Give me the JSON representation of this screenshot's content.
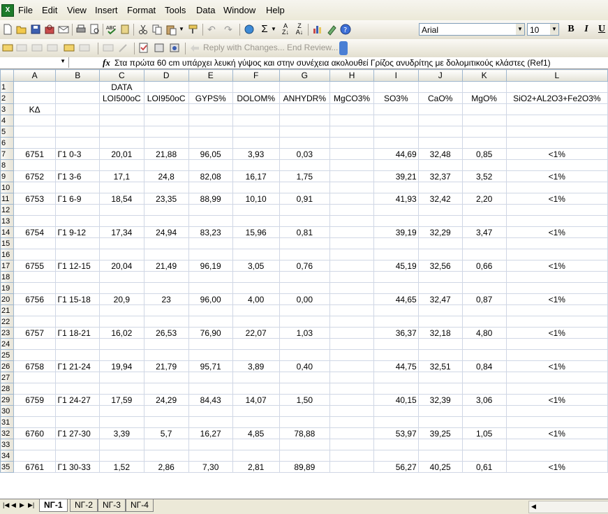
{
  "menu": [
    "File",
    "Edit",
    "View",
    "Insert",
    "Format",
    "Tools",
    "Data",
    "Window",
    "Help"
  ],
  "toolbar": {
    "font_name": "Arial",
    "font_size": "10",
    "bold": "B",
    "italic": "I",
    "underline": "U",
    "reply": "Reply with Changes...",
    "end_review": "End Review..."
  },
  "formula_bar": {
    "fx": "fx",
    "content": "Στα πρώτα 60 cm υπάρχει λευκή γύψος και στην συνέχεια ακολουθεί Γρίζος ανυδρίτης με δολομιτικούς κλάστες (Ref1)"
  },
  "columns": [
    "A",
    "B",
    "C",
    "D",
    "E",
    "F",
    "G",
    "H",
    "I",
    "J",
    "K",
    "L"
  ],
  "header_rows": {
    "r1": {
      "C": "DATA"
    },
    "r2": [
      "",
      "",
      "LOI500oC",
      "LOI950oC",
      "GYPS%",
      "DOLOM%",
      "ANHYDR%",
      "MgCO3%",
      "SO3%",
      "CaO%",
      "MgO%",
      "SiO2+AL2O3+Fe2O3%"
    ],
    "r3": {
      "A": "ΚΔ"
    }
  },
  "rows": [
    {
      "row": 7,
      "code": "6751",
      "sample": "Γ1 0-3",
      "loi500": "20,01",
      "loi950": "21,88",
      "gyps": "96,05",
      "dolom": "3,93",
      "anhydr": "0,03",
      "so3": "44,69",
      "cao": "32,48",
      "mgo": "0,85",
      "sio2": "<1%"
    },
    {
      "row": 9,
      "code": "6752",
      "sample": "Γ1 3-6",
      "loi500": "17,1",
      "loi950": "24,8",
      "gyps": "82,08",
      "dolom": "16,17",
      "anhydr": "1,75",
      "so3": "39,21",
      "cao": "32,37",
      "mgo": "3,52",
      "sio2": "<1%"
    },
    {
      "row": 11,
      "code": "6753",
      "sample": "Γ1 6-9",
      "loi500": "18,54",
      "loi950": "23,35",
      "gyps": "88,99",
      "dolom": "10,10",
      "anhydr": "0,91",
      "so3": "41,93",
      "cao": "32,42",
      "mgo": "2,20",
      "sio2": "<1%"
    },
    {
      "row": 14,
      "code": "6754",
      "sample": "Γ1 9-12",
      "loi500": "17,34",
      "loi950": "24,94",
      "gyps": "83,23",
      "dolom": "15,96",
      "anhydr": "0,81",
      "so3": "39,19",
      "cao": "32,29",
      "mgo": "3,47",
      "sio2": "<1%"
    },
    {
      "row": 17,
      "code": "6755",
      "sample": "Γ1 12-15",
      "loi500": "20,04",
      "loi950": "21,49",
      "gyps": "96,19",
      "dolom": "3,05",
      "anhydr": "0,76",
      "so3": "45,19",
      "cao": "32,56",
      "mgo": "0,66",
      "sio2": "<1%"
    },
    {
      "row": 20,
      "code": "6756",
      "sample": "Γ1 15-18",
      "loi500": "20,9",
      "loi950": "23",
      "gyps": "96,00",
      "dolom": "4,00",
      "anhydr": "0,00",
      "so3": "44,65",
      "cao": "32,47",
      "mgo": "0,87",
      "sio2": "<1%"
    },
    {
      "row": 23,
      "code": "6757",
      "sample": "Γ1 18-21",
      "loi500": "16,02",
      "loi950": "26,53",
      "gyps": "76,90",
      "dolom": "22,07",
      "anhydr": "1,03",
      "so3": "36,37",
      "cao": "32,18",
      "mgo": "4,80",
      "sio2": "<1%"
    },
    {
      "row": 26,
      "code": "6758",
      "sample": "Γ1 21-24",
      "loi500": "19,94",
      "loi950": "21,79",
      "gyps": "95,71",
      "dolom": "3,89",
      "anhydr": "0,40",
      "so3": "44,75",
      "cao": "32,51",
      "mgo": "0,84",
      "sio2": "<1%"
    },
    {
      "row": 29,
      "code": "6759",
      "sample": "Γ1 24-27",
      "loi500": "17,59",
      "loi950": "24,29",
      "gyps": "84,43",
      "dolom": "14,07",
      "anhydr": "1,50",
      "so3": "40,15",
      "cao": "32,39",
      "mgo": "3,06",
      "sio2": "<1%"
    },
    {
      "row": 32,
      "code": "6760",
      "sample": "Γ1 27-30",
      "loi500": "3,39",
      "loi950": "5,7",
      "gyps": "16,27",
      "dolom": "4,85",
      "anhydr": "78,88",
      "so3": "53,97",
      "cao": "39,25",
      "mgo": "1,05",
      "sio2": "<1%"
    },
    {
      "row": 35,
      "code": "6761",
      "sample": "Γ1 30-33",
      "loi500": "1,52",
      "loi950": "2,86",
      "gyps": "7,30",
      "dolom": "2,81",
      "anhydr": "89,89",
      "so3": "56,27",
      "cao": "40,25",
      "mgo": "0,61",
      "sio2": "<1%"
    }
  ],
  "last_row": 35,
  "sheet_tabs": [
    "ΝΓ-1",
    "ΝΓ-2",
    "ΝΓ-3",
    "ΝΓ-4"
  ],
  "active_tab": 0,
  "accent": "#316ac5"
}
